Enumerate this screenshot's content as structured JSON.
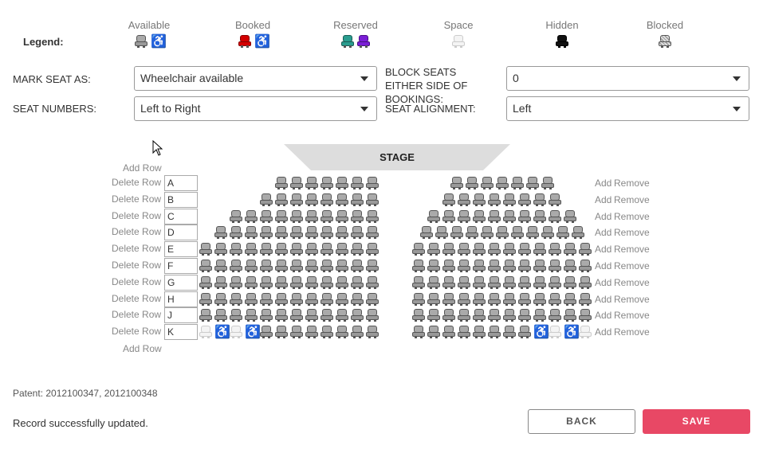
{
  "legend": {
    "label": "Legend:",
    "groups": [
      {
        "title": "Available",
        "icons": [
          "seat-available",
          "wheelchair-available"
        ]
      },
      {
        "title": "Booked",
        "icons": [
          "seat-booked",
          "wheelchair-booked"
        ]
      },
      {
        "title": "Reserved",
        "icons": [
          "seat-reserved-teal",
          "seat-reserved-purple"
        ]
      },
      {
        "title": "Space",
        "icons": [
          "seat-space"
        ]
      },
      {
        "title": "Hidden",
        "icons": [
          "seat-hidden"
        ]
      },
      {
        "title": "Blocked",
        "icons": [
          "seat-blocked"
        ]
      }
    ]
  },
  "form": {
    "mark_seat_as": {
      "label": "MARK SEAT AS:",
      "value": "Wheelchair available"
    },
    "block_seats": {
      "label": "BLOCK SEATS EITHER SIDE OF BOOKINGS:",
      "value": "0"
    },
    "seat_numbers": {
      "label": "SEAT NUMBERS:",
      "value": "Left to Right"
    },
    "seat_alignment": {
      "label": "SEAT ALIGNMENT:",
      "value": "Left"
    }
  },
  "stage": {
    "label": "STAGE"
  },
  "rows": {
    "add_row_label": "Add Row",
    "delete_row_label": "Delete Row",
    "add_label": "Add",
    "remove_label": "Remove",
    "names": [
      "A",
      "B",
      "C",
      "D",
      "E",
      "F",
      "G",
      "H",
      "J",
      "K"
    ],
    "left_counts": [
      7,
      8,
      10,
      11,
      12,
      12,
      12,
      12,
      12,
      12
    ],
    "right_counts": [
      7,
      8,
      10,
      11,
      12,
      12,
      12,
      12,
      12,
      12
    ],
    "k_left": [
      "space",
      "wc",
      "space",
      "wc",
      "a",
      "a",
      "a",
      "a",
      "a",
      "a",
      "a",
      "a"
    ],
    "k_right": [
      "a",
      "a",
      "a",
      "a",
      "a",
      "a",
      "a",
      "a",
      "wc",
      "space",
      "wc",
      "space"
    ]
  },
  "footer": {
    "patent": "Patent: 2012100347, 2012100348",
    "message": "Record successfully updated.",
    "back_label": "BACK",
    "save_label": "SAVE"
  },
  "colors": {
    "save": "#e84865",
    "wheelchair": "#1a6fd1",
    "booked": "#d40000"
  }
}
